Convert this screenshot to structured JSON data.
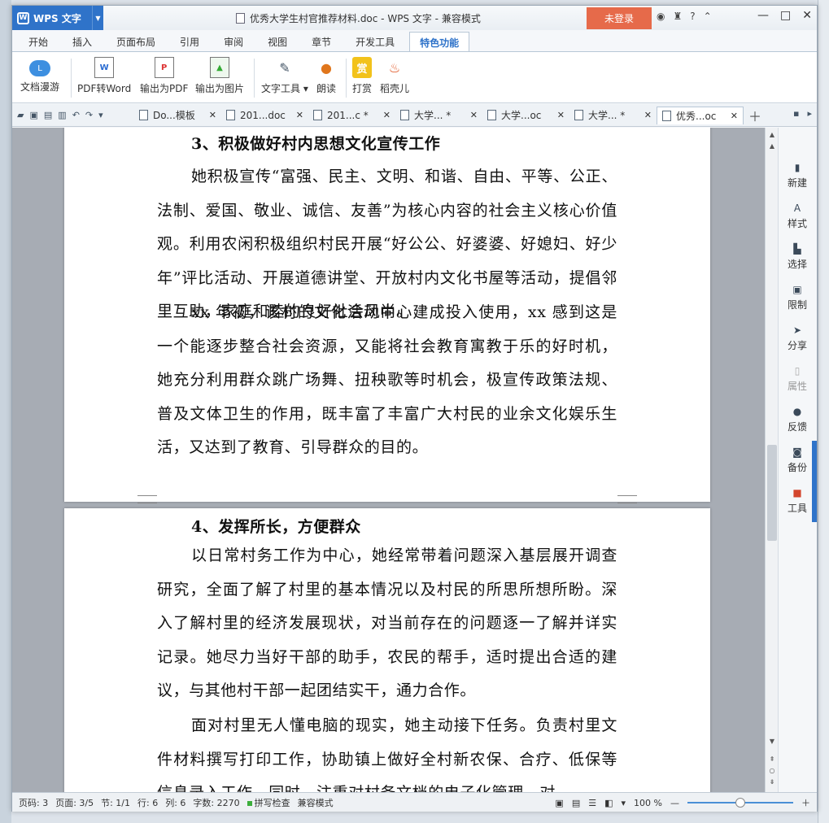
{
  "app": {
    "name": "WPS 文字",
    "doc_title": "优秀大学生村官推荐材料.doc - WPS 文字 - 兼容模式",
    "login_label": "未登录",
    "help_label": "?"
  },
  "ribbon_tabs": [
    {
      "label": "开始"
    },
    {
      "label": "插入"
    },
    {
      "label": "页面布局"
    },
    {
      "label": "引用"
    },
    {
      "label": "审阅"
    },
    {
      "label": "视图"
    },
    {
      "label": "章节"
    },
    {
      "label": "开发工具"
    },
    {
      "label": "特色功能",
      "active": true
    }
  ],
  "ribbon_buttons": {
    "roam": "文档漫游",
    "pdf_to_word": "PDF转Word",
    "export_pdf": "输出为PDF",
    "export_image": "输出为图片",
    "text_tools": "文字工具",
    "read_aloud": "朗读",
    "reward": "打赏",
    "daoke": "稻壳儿"
  },
  "doc_tabs": [
    {
      "label": "Do...模板"
    },
    {
      "label": "201...doc"
    },
    {
      "label": "201...c *"
    },
    {
      "label": "大学... *"
    },
    {
      "label": "大学...oc"
    },
    {
      "label": "大学... *"
    },
    {
      "label": "优秀...oc",
      "active": true
    }
  ],
  "document": {
    "heading3": "3、积极做好村内思想文化宣传工作",
    "para3a": "她积极宣传“富强、民主、文明、和谐、自由、平等、公正、法制、爱国、敬业、诚信、友善”为核心内容的社会主义核心价值观。利用农闲积极组织村民开展“好公公、好婆婆、好媳妇、好少年”评比活动、开展道德讲堂、开放村内文化书屋等活动，提倡邻里互助，家庭和睦的良好社会风尚。",
    "para3b": "xx 年初，该村的文化活动中心建成投入使用，xx 感到这是一个能逐步整合社会资源，又能将社会教育寓教于乐的好时机，她充分利用群众跳广场舞、扭秧歌等时机会，极宣传政策法规、普及文体卫生的作用，既丰富了丰富广大村民的业余文化娱乐生活，又达到了教育、引导群众的目的。",
    "heading4": "4、发挥所长，方便群众",
    "para4a": "以日常村务工作为中心，她经常带着问题深入基层展开调查研究，全面了解了村里的基本情况以及村民的所思所想所盼。深入了解村里的经济发展现状，对当前存在的问题逐一了解并详实记录。她尽力当好干部的助手，农民的帮手，适时提出合适的建议，与其他村干部一起团结实干，通力合作。",
    "para4b": "面对村里无人懂电脑的现实，她主动接下任务。负责村里文件材料撰写打印工作，协助镇上做好全村新农保、合疗、低保等信息录入工作，同时，注重对村务文档的电子化管理，对"
  },
  "side_panel": [
    {
      "label": "新建",
      "icon": "new-doc-icon"
    },
    {
      "label": "样式",
      "icon": "style-icon"
    },
    {
      "label": "选择",
      "icon": "select-icon"
    },
    {
      "label": "限制",
      "icon": "lock-icon"
    },
    {
      "label": "分享",
      "icon": "share-icon"
    },
    {
      "label": "属性",
      "icon": "properties-icon",
      "disabled": true
    },
    {
      "label": "反馈",
      "icon": "feedback-icon"
    },
    {
      "label": "备份",
      "icon": "backup-icon"
    },
    {
      "label": "工具",
      "icon": "toolbox-icon"
    }
  ],
  "status": {
    "page_code": "页码: 3",
    "page": "页面: 3/5",
    "section": "节: 1/1",
    "row": "行: 6",
    "col": "列: 6",
    "word_count": "字数: 2270",
    "spell_check": "拼写检查",
    "compat_mode": "兼容模式",
    "zoom": "100 %",
    "zoom_level": 0.5
  },
  "colors": {
    "app_blue": "#2f73c9",
    "login_red": "#e66a4a"
  }
}
